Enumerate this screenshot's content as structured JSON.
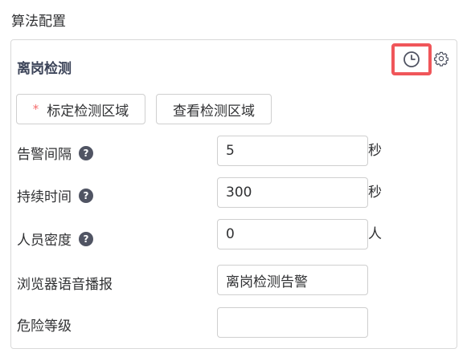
{
  "page": {
    "title": "算法配置"
  },
  "panel": {
    "title": "离岗检测",
    "icons": {
      "clock": "clock-icon",
      "gear": "gear-icon"
    },
    "colors": {
      "highlight": "#f0565a",
      "title": "#3b4358",
      "required": "#f56c6c",
      "help": "#505463"
    }
  },
  "actions": {
    "mark_area_required": "*",
    "mark_area_label": "标定检测区域",
    "view_area_label": "查看检测区域"
  },
  "fields": {
    "alarm_interval": {
      "label": "告警间隔",
      "help": "?",
      "value": "5",
      "unit": "秒"
    },
    "duration": {
      "label": "持续时间",
      "help": "?",
      "value": "300",
      "unit": "秒"
    },
    "density": {
      "label": "人员密度",
      "help": "?",
      "value": "0",
      "unit": "人"
    },
    "voice_broadcast": {
      "label": "浏览器语音播报",
      "value": "离岗检测告警"
    },
    "danger_level": {
      "label": "危险等级",
      "value": ""
    }
  }
}
